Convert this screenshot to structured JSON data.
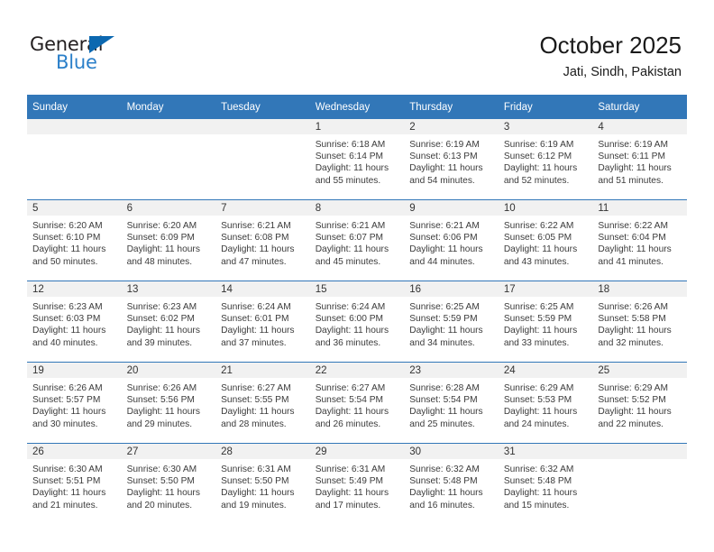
{
  "branding": {
    "name_top": "General",
    "name_bottom": "Blue",
    "triangle_color": "#0c68b0",
    "blue_text_color": "#2a7fc9"
  },
  "header": {
    "month_title": "October 2025",
    "location": "Jati, Sindh, Pakistan"
  },
  "theme": {
    "header_row_bg": "#3277b8",
    "daynum_strip_bg": "#f1f1f1",
    "grid_line": "#3277b8",
    "page_bg": "#ffffff"
  },
  "calendar": {
    "weekday_headers": [
      "Sunday",
      "Monday",
      "Tuesday",
      "Wednesday",
      "Thursday",
      "Friday",
      "Saturday"
    ],
    "weeks": [
      [
        {
          "empty": true
        },
        {
          "empty": true
        },
        {
          "empty": true
        },
        {
          "day": "1",
          "sunrise": "Sunrise: 6:18 AM",
          "sunset": "Sunset: 6:14 PM",
          "daylight_1": "Daylight: 11 hours",
          "daylight_2": "and 55 minutes."
        },
        {
          "day": "2",
          "sunrise": "Sunrise: 6:19 AM",
          "sunset": "Sunset: 6:13 PM",
          "daylight_1": "Daylight: 11 hours",
          "daylight_2": "and 54 minutes."
        },
        {
          "day": "3",
          "sunrise": "Sunrise: 6:19 AM",
          "sunset": "Sunset: 6:12 PM",
          "daylight_1": "Daylight: 11 hours",
          "daylight_2": "and 52 minutes."
        },
        {
          "day": "4",
          "sunrise": "Sunrise: 6:19 AM",
          "sunset": "Sunset: 6:11 PM",
          "daylight_1": "Daylight: 11 hours",
          "daylight_2": "and 51 minutes."
        }
      ],
      [
        {
          "day": "5",
          "sunrise": "Sunrise: 6:20 AM",
          "sunset": "Sunset: 6:10 PM",
          "daylight_1": "Daylight: 11 hours",
          "daylight_2": "and 50 minutes."
        },
        {
          "day": "6",
          "sunrise": "Sunrise: 6:20 AM",
          "sunset": "Sunset: 6:09 PM",
          "daylight_1": "Daylight: 11 hours",
          "daylight_2": "and 48 minutes."
        },
        {
          "day": "7",
          "sunrise": "Sunrise: 6:21 AM",
          "sunset": "Sunset: 6:08 PM",
          "daylight_1": "Daylight: 11 hours",
          "daylight_2": "and 47 minutes."
        },
        {
          "day": "8",
          "sunrise": "Sunrise: 6:21 AM",
          "sunset": "Sunset: 6:07 PM",
          "daylight_1": "Daylight: 11 hours",
          "daylight_2": "and 45 minutes."
        },
        {
          "day": "9",
          "sunrise": "Sunrise: 6:21 AM",
          "sunset": "Sunset: 6:06 PM",
          "daylight_1": "Daylight: 11 hours",
          "daylight_2": "and 44 minutes."
        },
        {
          "day": "10",
          "sunrise": "Sunrise: 6:22 AM",
          "sunset": "Sunset: 6:05 PM",
          "daylight_1": "Daylight: 11 hours",
          "daylight_2": "and 43 minutes."
        },
        {
          "day": "11",
          "sunrise": "Sunrise: 6:22 AM",
          "sunset": "Sunset: 6:04 PM",
          "daylight_1": "Daylight: 11 hours",
          "daylight_2": "and 41 minutes."
        }
      ],
      [
        {
          "day": "12",
          "sunrise": "Sunrise: 6:23 AM",
          "sunset": "Sunset: 6:03 PM",
          "daylight_1": "Daylight: 11 hours",
          "daylight_2": "and 40 minutes."
        },
        {
          "day": "13",
          "sunrise": "Sunrise: 6:23 AM",
          "sunset": "Sunset: 6:02 PM",
          "daylight_1": "Daylight: 11 hours",
          "daylight_2": "and 39 minutes."
        },
        {
          "day": "14",
          "sunrise": "Sunrise: 6:24 AM",
          "sunset": "Sunset: 6:01 PM",
          "daylight_1": "Daylight: 11 hours",
          "daylight_2": "and 37 minutes."
        },
        {
          "day": "15",
          "sunrise": "Sunrise: 6:24 AM",
          "sunset": "Sunset: 6:00 PM",
          "daylight_1": "Daylight: 11 hours",
          "daylight_2": "and 36 minutes."
        },
        {
          "day": "16",
          "sunrise": "Sunrise: 6:25 AM",
          "sunset": "Sunset: 5:59 PM",
          "daylight_1": "Daylight: 11 hours",
          "daylight_2": "and 34 minutes."
        },
        {
          "day": "17",
          "sunrise": "Sunrise: 6:25 AM",
          "sunset": "Sunset: 5:59 PM",
          "daylight_1": "Daylight: 11 hours",
          "daylight_2": "and 33 minutes."
        },
        {
          "day": "18",
          "sunrise": "Sunrise: 6:26 AM",
          "sunset": "Sunset: 5:58 PM",
          "daylight_1": "Daylight: 11 hours",
          "daylight_2": "and 32 minutes."
        }
      ],
      [
        {
          "day": "19",
          "sunrise": "Sunrise: 6:26 AM",
          "sunset": "Sunset: 5:57 PM",
          "daylight_1": "Daylight: 11 hours",
          "daylight_2": "and 30 minutes."
        },
        {
          "day": "20",
          "sunrise": "Sunrise: 6:26 AM",
          "sunset": "Sunset: 5:56 PM",
          "daylight_1": "Daylight: 11 hours",
          "daylight_2": "and 29 minutes."
        },
        {
          "day": "21",
          "sunrise": "Sunrise: 6:27 AM",
          "sunset": "Sunset: 5:55 PM",
          "daylight_1": "Daylight: 11 hours",
          "daylight_2": "and 28 minutes."
        },
        {
          "day": "22",
          "sunrise": "Sunrise: 6:27 AM",
          "sunset": "Sunset: 5:54 PM",
          "daylight_1": "Daylight: 11 hours",
          "daylight_2": "and 26 minutes."
        },
        {
          "day": "23",
          "sunrise": "Sunrise: 6:28 AM",
          "sunset": "Sunset: 5:54 PM",
          "daylight_1": "Daylight: 11 hours",
          "daylight_2": "and 25 minutes."
        },
        {
          "day": "24",
          "sunrise": "Sunrise: 6:29 AM",
          "sunset": "Sunset: 5:53 PM",
          "daylight_1": "Daylight: 11 hours",
          "daylight_2": "and 24 minutes."
        },
        {
          "day": "25",
          "sunrise": "Sunrise: 6:29 AM",
          "sunset": "Sunset: 5:52 PM",
          "daylight_1": "Daylight: 11 hours",
          "daylight_2": "and 22 minutes."
        }
      ],
      [
        {
          "day": "26",
          "sunrise": "Sunrise: 6:30 AM",
          "sunset": "Sunset: 5:51 PM",
          "daylight_1": "Daylight: 11 hours",
          "daylight_2": "and 21 minutes."
        },
        {
          "day": "27",
          "sunrise": "Sunrise: 6:30 AM",
          "sunset": "Sunset: 5:50 PM",
          "daylight_1": "Daylight: 11 hours",
          "daylight_2": "and 20 minutes."
        },
        {
          "day": "28",
          "sunrise": "Sunrise: 6:31 AM",
          "sunset": "Sunset: 5:50 PM",
          "daylight_1": "Daylight: 11 hours",
          "daylight_2": "and 19 minutes."
        },
        {
          "day": "29",
          "sunrise": "Sunrise: 6:31 AM",
          "sunset": "Sunset: 5:49 PM",
          "daylight_1": "Daylight: 11 hours",
          "daylight_2": "and 17 minutes."
        },
        {
          "day": "30",
          "sunrise": "Sunrise: 6:32 AM",
          "sunset": "Sunset: 5:48 PM",
          "daylight_1": "Daylight: 11 hours",
          "daylight_2": "and 16 minutes."
        },
        {
          "day": "31",
          "sunrise": "Sunrise: 6:32 AM",
          "sunset": "Sunset: 5:48 PM",
          "daylight_1": "Daylight: 11 hours",
          "daylight_2": "and 15 minutes."
        },
        {
          "empty": true
        }
      ]
    ]
  }
}
